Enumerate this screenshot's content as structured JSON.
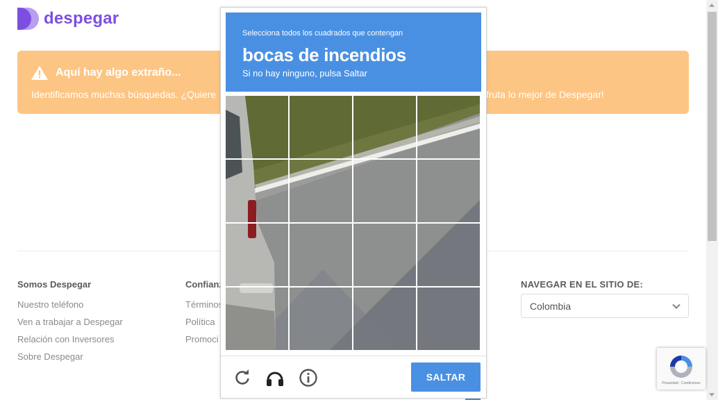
{
  "brand": {
    "name": "despegar",
    "color": "#7d4fe0"
  },
  "alert": {
    "title": "Aquí hay algo extraño...",
    "text_left": "Identificamos muchas búsquedas. ¿Quiere",
    "text_right": "fruta lo mejor de Despegar!",
    "background": "#fdc583",
    "icon": "warning-icon"
  },
  "footer": {
    "col1": {
      "title": "Somos Despegar",
      "links": [
        "Nuestro teléfono",
        "Ven a trabajar a Despegar",
        "Relación con Inversores",
        "Sobre Despegar"
      ]
    },
    "col2": {
      "title": "Confianz",
      "links": [
        "Términos",
        "Política",
        "Promoci"
      ]
    },
    "nav_title": "NAVEGAR EN EL SITIO DE:",
    "country": "Colombia"
  },
  "recaptcha_badge": {
    "text": "Privacidad - Condiciones"
  },
  "challenge": {
    "instruction": "Selecciona todos los cuadrados que contengan",
    "target": "bocas de incendios",
    "hint": "Si no hay ninguno, pulsa Saltar",
    "accent": "#4a90e2",
    "skip_label": "SALTAR",
    "controls": [
      "reload-icon",
      "audio-headphones-icon",
      "info-icon"
    ],
    "grid": {
      "rows": 4,
      "cols": 4
    }
  }
}
